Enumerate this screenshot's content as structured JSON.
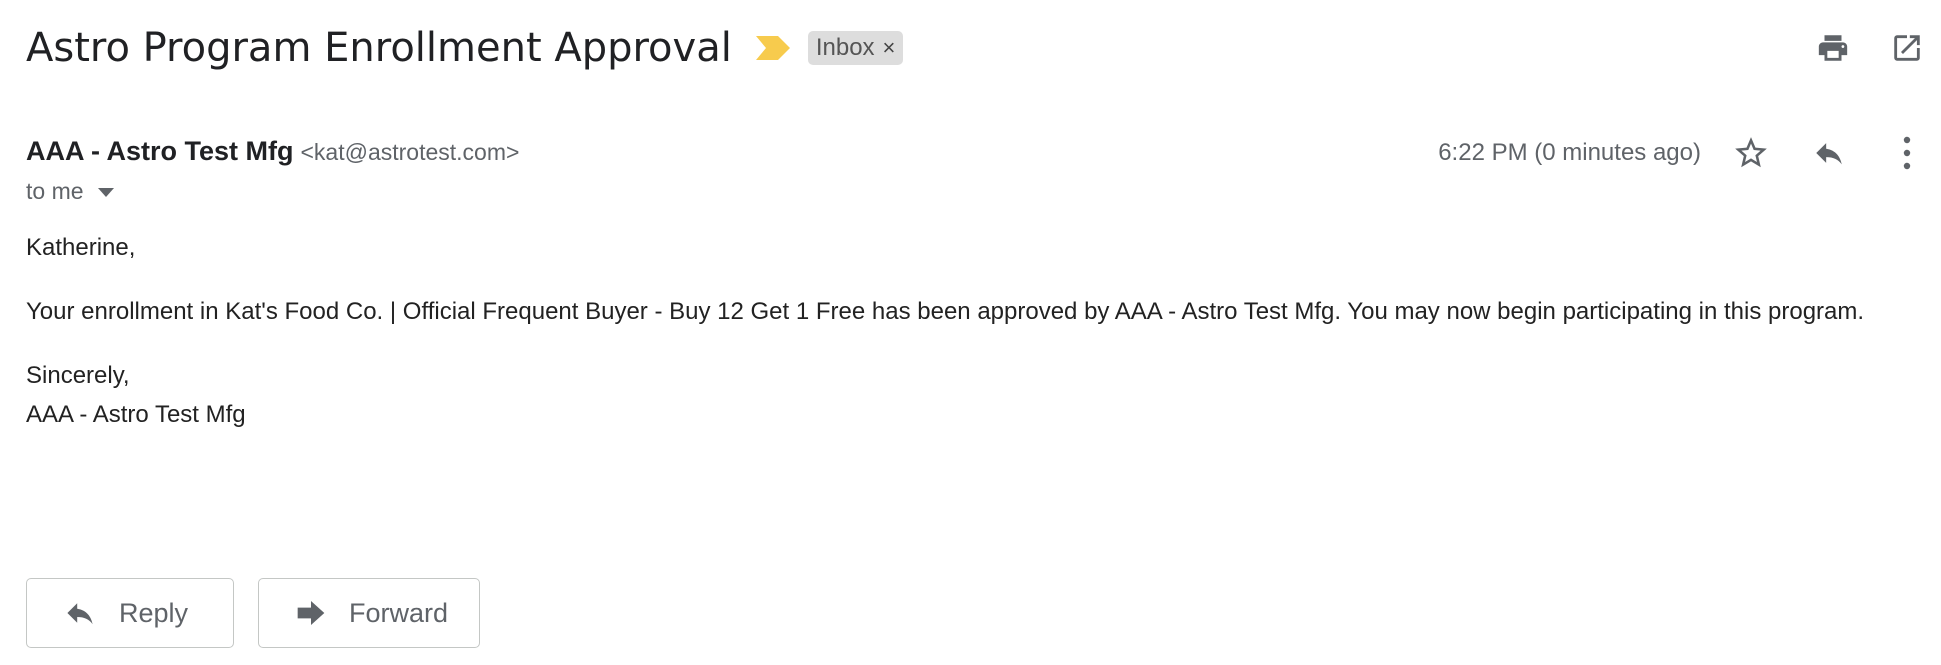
{
  "subject": "Astro Program Enrollment Approval",
  "label": {
    "name": "Inbox",
    "remove": "×"
  },
  "sender": {
    "name": "AAA - Astro Test Mfg",
    "email": "<kat@astrotest.com>"
  },
  "recipient": "to me",
  "timestamp": "6:22 PM (0 minutes ago)",
  "body": {
    "greeting": "Katherine,",
    "message": "Your enrollment in Kat's Food Co. | Official Frequent Buyer - Buy 12 Get 1 Free has been approved by AAA - Astro Test Mfg. You may now begin participating in this program.",
    "closing": "Sincerely,",
    "signature": "AAA - Astro Test Mfg"
  },
  "actions": {
    "reply": "Reply",
    "forward": "Forward"
  },
  "icons": {
    "importance": "importance-marker-icon",
    "print": "print-icon",
    "open_new_window": "open-in-new-window-icon",
    "star": "star-icon",
    "reply": "reply-icon",
    "more": "more-vertical-icon",
    "forward": "forward-icon"
  },
  "colors": {
    "importance": "#f7cb4d",
    "icon_gray": "#5f6368",
    "chip_bg": "#dddddd"
  }
}
